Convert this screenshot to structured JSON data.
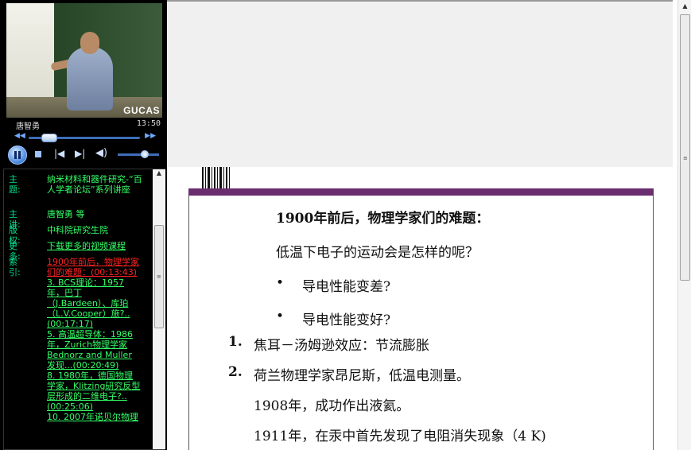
{
  "player": {
    "watermark": "GUCAS",
    "speaker_name": "唐智勇",
    "elapsed": "13:50",
    "icons": {
      "rewind": "rewind-icon",
      "forward": "fast-forward-icon",
      "pause": "pause-icon",
      "stop": "stop-icon",
      "previous": "previous-icon",
      "next": "next-icon",
      "volume": "volume-icon"
    },
    "seek_fraction": 0.18,
    "volume_fraction": 0.65
  },
  "info": {
    "topic_label": "主题:",
    "topic_value": "纳米材料和器件研究-“百人学者论坛”系列讲座",
    "speaker_label": "主讲:",
    "speaker_value": "唐智勇 等",
    "copyright_label": "版权:",
    "copyright_value": "中科院研究生院",
    "more_label": "更多:",
    "more_value": "下载更多的视频课程",
    "index_label": "索引:",
    "index_items": [
      "1900年前后，物理学家们的难题：(00:13:43)",
      "3. BCS理论：1957年，巴丁（J.Bardeen）、库珀（L.V.Cooper）施?..(00:17:17)",
      "5. 高温超导体：1986年，Zurich物理学家Bednorz and Muller 发现...(00:20:49)",
      "8. 1980年，德国物理学家，Klitzing研究反型层形成的二维电子?..(00:25:06)",
      "10. 2007年诺贝尔物理"
    ]
  },
  "slide": {
    "lines": [
      "1900年前后，物理学家们的难题：",
      "低温下电子的运动会是怎样的呢？",
      "•",
      "导电性能变差?",
      "•",
      "导电性能变好?",
      "1.",
      "焦耳－汤姆逊效应：节流膨胀",
      "2.",
      "荷兰物理学家昂尼斯，低温电测量。",
      "1908年，成功作出液氦。",
      "1911年，在汞中首先发现了电阻消失现象（4 K)"
    ]
  }
}
